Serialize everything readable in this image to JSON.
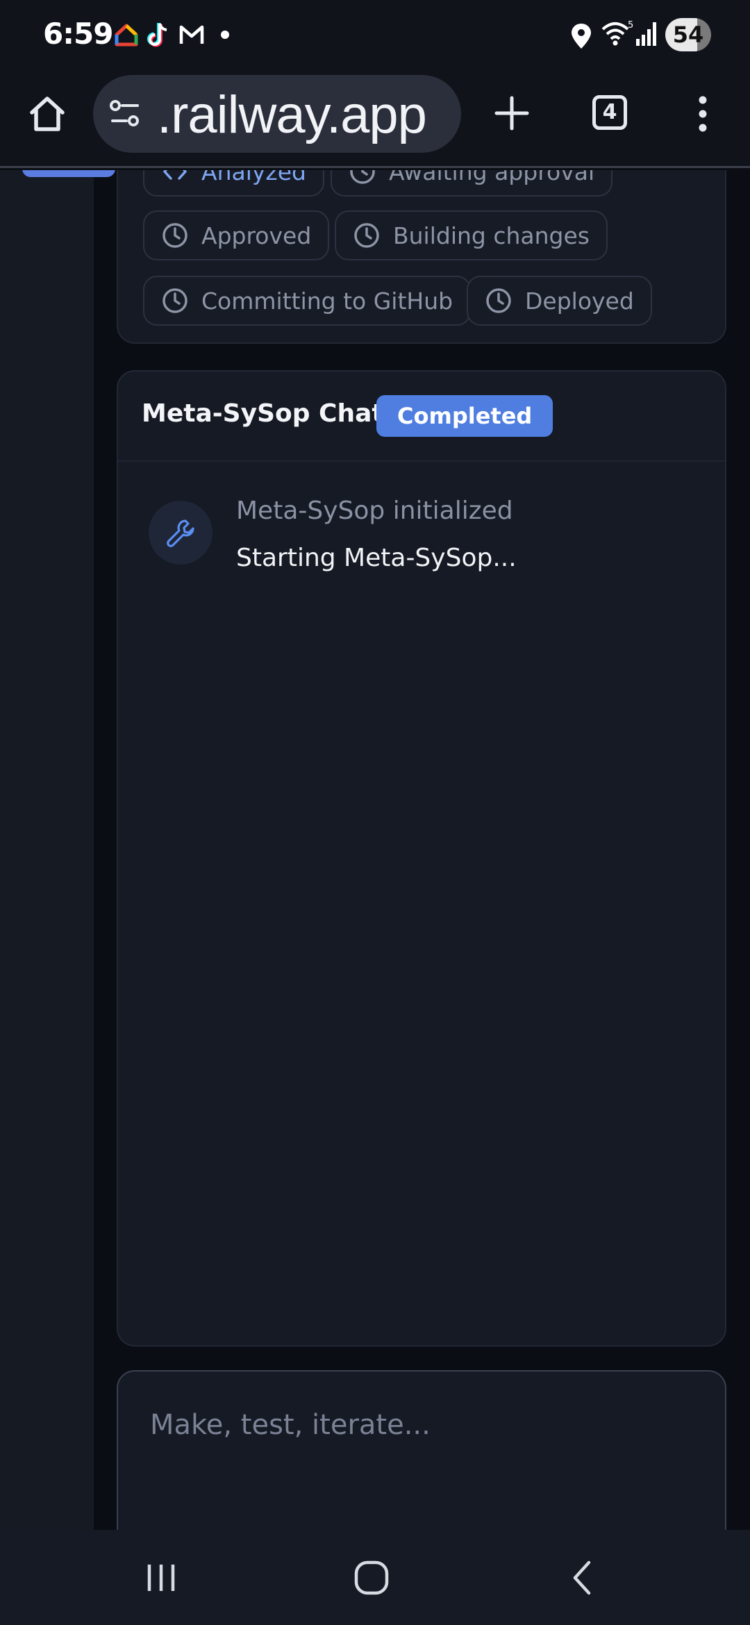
{
  "status_bar": {
    "time": "6:59",
    "app_icons": [
      "google-home-icon",
      "tiktok-icon",
      "gmail-icon"
    ],
    "battery": "54",
    "wifi_label": "5"
  },
  "browser": {
    "url": ".railway.app",
    "tab_count": "4"
  },
  "progress_steps": [
    {
      "label": "Analyzed",
      "state": "done"
    },
    {
      "label": "Awaiting approval",
      "state": "pending"
    },
    {
      "label": "Approved",
      "state": "pending"
    },
    {
      "label": "Building changes",
      "state": "pending"
    },
    {
      "label": "Committing to GitHub",
      "state": "pending"
    },
    {
      "label": "Deployed",
      "state": "pending"
    }
  ],
  "chat": {
    "title": "Meta-SySop Chat",
    "status_badge": "Completed",
    "messages": [
      {
        "title": "Meta-SySop initialized",
        "body": "Starting Meta-SySop...",
        "icon": "wrench-icon"
      }
    ]
  },
  "composer": {
    "placeholder": "Make, test, iterate..."
  },
  "colors": {
    "accent": "#4f7ee0",
    "background": "#0a0d13",
    "card": "#161a24"
  }
}
